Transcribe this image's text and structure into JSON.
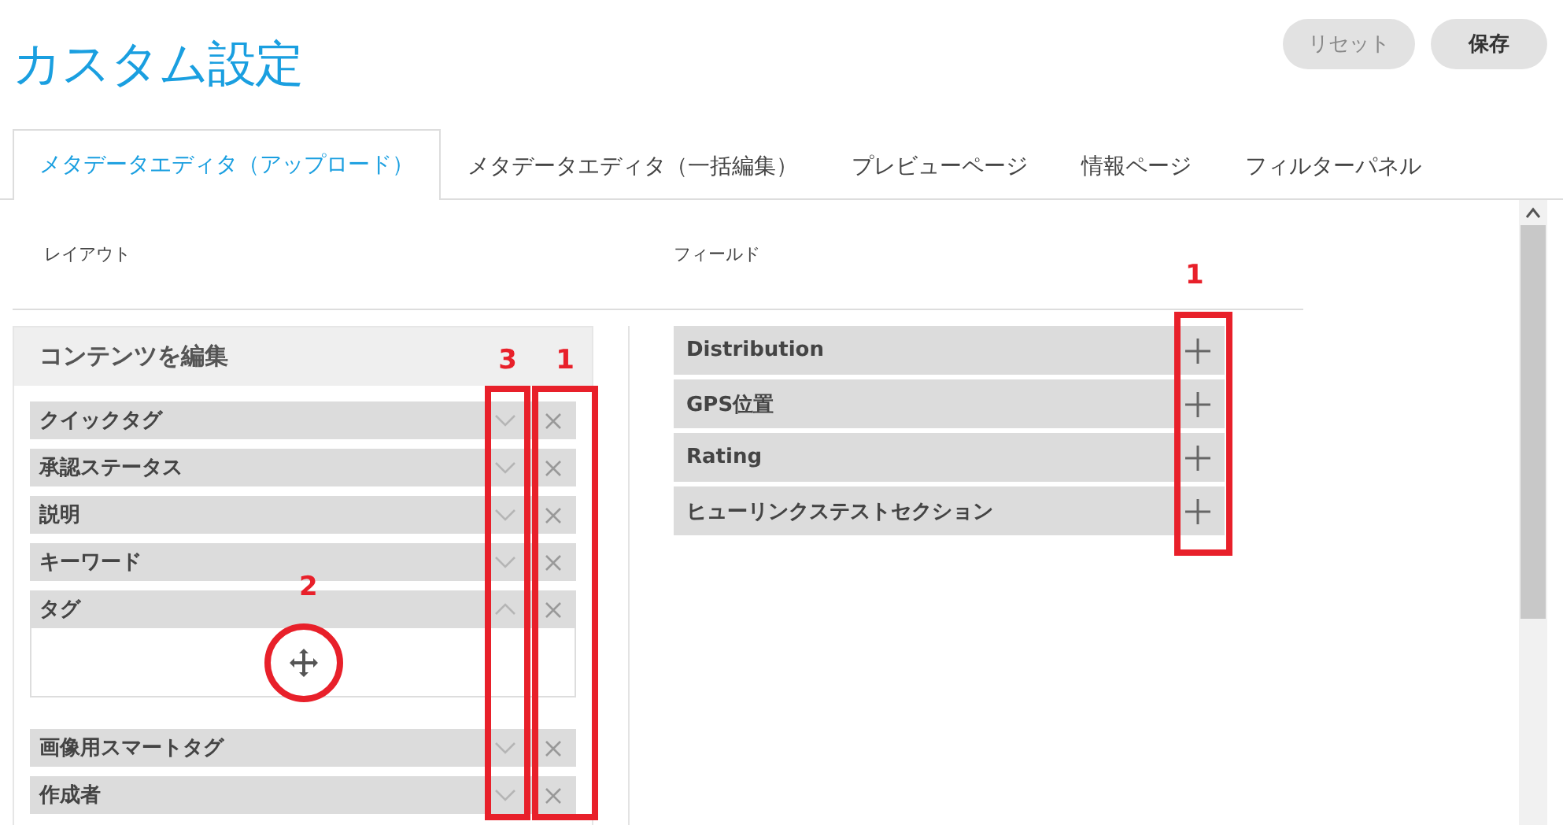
{
  "header": {
    "title": "カスタム設定",
    "buttons": [
      {
        "label": "リセット",
        "disabled": true
      },
      {
        "label": "保存",
        "disabled": false
      }
    ]
  },
  "tabs": [
    {
      "label": "メタデータエディタ（アップロード）",
      "selected": true
    },
    {
      "label": "メタデータエディタ（一括編集）",
      "selected": false
    },
    {
      "label": "プレビューページ",
      "selected": false
    },
    {
      "label": "情報ページ",
      "selected": false
    },
    {
      "label": "フィルターパネル",
      "selected": false
    }
  ],
  "layout": {
    "heading": "レイアウト",
    "panel_title": "コンテンツを編集",
    "items": [
      {
        "label": "クイックタグ",
        "expanded": false
      },
      {
        "label": "承認ステータス",
        "expanded": false
      },
      {
        "label": "説明",
        "expanded": false
      },
      {
        "label": "キーワード",
        "expanded": false
      },
      {
        "label": "タグ",
        "expanded": true
      },
      {
        "label": "画像用スマートタグ",
        "expanded": false
      },
      {
        "label": "作成者",
        "expanded": false
      }
    ],
    "callouts": {
      "toggle_column": "3",
      "remove_column": "1",
      "move_handle": "2"
    }
  },
  "fields": {
    "heading": "フィールド",
    "callout": "1",
    "items": [
      {
        "label": "Distribution"
      },
      {
        "label": "GPS位置"
      },
      {
        "label": "Rating"
      },
      {
        "label": "ヒューリンクステストセクション"
      }
    ]
  }
}
